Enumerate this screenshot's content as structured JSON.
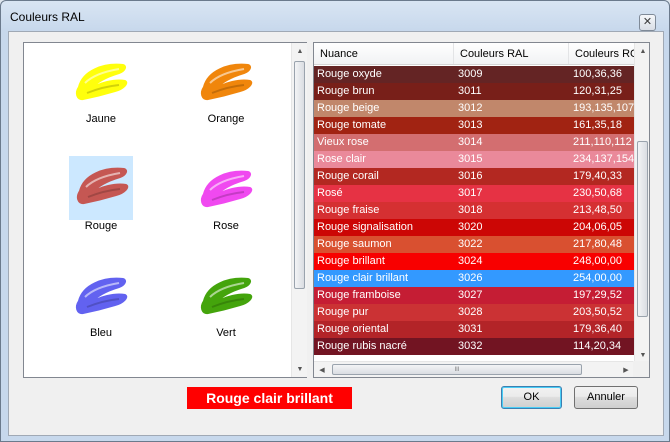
{
  "window": {
    "title": "Couleurs RAL",
    "close_glyph": "✕"
  },
  "swatches": [
    {
      "label": "Jaune",
      "color": "#ffff00",
      "selected": false
    },
    {
      "label": "Orange",
      "color": "#f08000",
      "selected": false
    },
    {
      "label": "Rouge",
      "color": "#c5504a",
      "selected": true
    },
    {
      "label": "Rose",
      "color": "#f040f0",
      "selected": false
    },
    {
      "label": "Bleu",
      "color": "#5a5af0",
      "selected": false
    },
    {
      "label": "Vert",
      "color": "#3aa000",
      "selected": false
    }
  ],
  "grid": {
    "columns": [
      "Nuance",
      "Couleurs RAL",
      "Couleurs RGB"
    ],
    "rows": [
      {
        "name": "Rouge oxyde",
        "ral": "3009",
        "rgb": "100,36,36",
        "bg": "#642424",
        "selected": false
      },
      {
        "name": "Rouge brun",
        "ral": "3011",
        "rgb": "120,31,25",
        "bg": "#781f19",
        "selected": false
      },
      {
        "name": "Rouge beige",
        "ral": "3012",
        "rgb": "193,135,107",
        "bg": "#c1876b",
        "selected": false
      },
      {
        "name": "Rouge tomate",
        "ral": "3013",
        "rgb": "161,35,18",
        "bg": "#a12312",
        "selected": false
      },
      {
        "name": "Vieux rose",
        "ral": "3014",
        "rgb": "211,110,112",
        "bg": "#d36e70",
        "selected": false
      },
      {
        "name": "Rose clair",
        "ral": "3015",
        "rgb": "234,137,154",
        "bg": "#ea899a",
        "selected": false
      },
      {
        "name": "Rouge corail",
        "ral": "3016",
        "rgb": "179,40,33",
        "bg": "#b32821",
        "selected": false
      },
      {
        "name": "Rosé",
        "ral": "3017",
        "rgb": "230,50,68",
        "bg": "#e63244",
        "selected": false
      },
      {
        "name": "Rouge fraise",
        "ral": "3018",
        "rgb": "213,48,50",
        "bg": "#d53032",
        "selected": false
      },
      {
        "name": "Rouge signalisation",
        "ral": "3020",
        "rgb": "204,06,05",
        "bg": "#cc0605",
        "selected": false
      },
      {
        "name": "Rouge saumon",
        "ral": "3022",
        "rgb": "217,80,48",
        "bg": "#d95030",
        "selected": false
      },
      {
        "name": "Rouge brillant",
        "ral": "3024",
        "rgb": "248,00,00",
        "bg": "#f80000",
        "selected": false
      },
      {
        "name": "Rouge clair brillant",
        "ral": "3026",
        "rgb": "254,00,00",
        "bg": "#3399ff",
        "selected": true
      },
      {
        "name": "Rouge framboise",
        "ral": "3027",
        "rgb": "197,29,52",
        "bg": "#c51d34",
        "selected": false
      },
      {
        "name": "Rouge pur",
        "ral": "3028",
        "rgb": "203,50,52",
        "bg": "#cb3234",
        "selected": false
      },
      {
        "name": "Rouge oriental",
        "ral": "3031",
        "rgb": "179,36,40",
        "bg": "#b32428",
        "selected": false
      },
      {
        "name": "Rouge rubis nacré",
        "ral": "3032",
        "rgb": "114,20,34",
        "bg": "#721422",
        "selected": false
      }
    ],
    "hscroll_grip": "III"
  },
  "preview": {
    "text": "Rouge clair brillant",
    "color": "#ff0000"
  },
  "buttons": {
    "ok": "OK",
    "cancel": "Annuler"
  }
}
